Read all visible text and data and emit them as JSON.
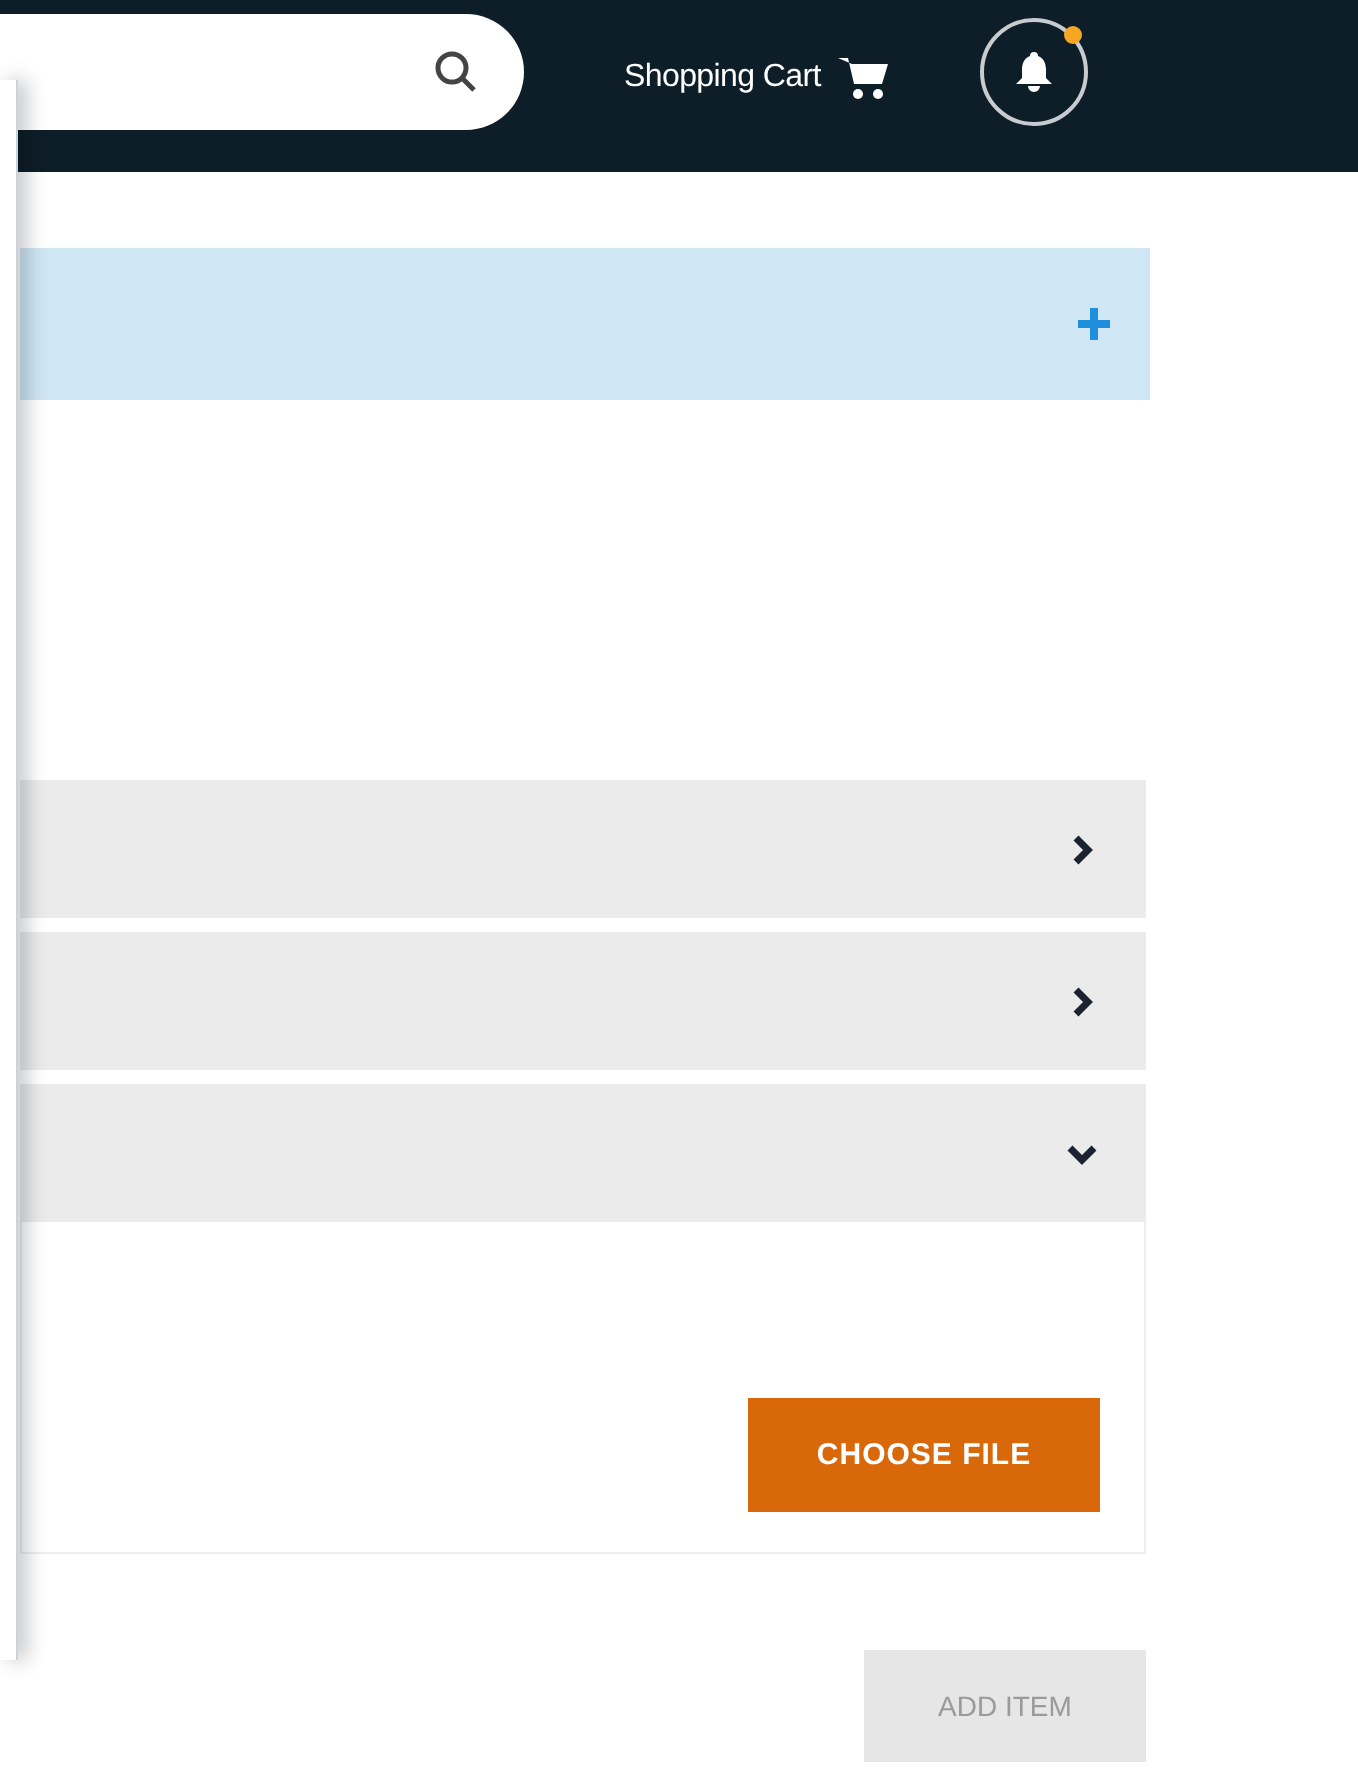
{
  "header": {
    "cart_label": "Shopping Cart",
    "notifications": {
      "unread": true
    }
  },
  "banner": {
    "expanded": false
  },
  "sections": [
    {
      "expanded": false
    },
    {
      "expanded": false
    },
    {
      "expanded": true,
      "button": "CHOOSE FILE"
    }
  ],
  "add_button": {
    "label": "ADD ITEM",
    "disabled": true
  },
  "side_panel": {
    "open": true
  }
}
